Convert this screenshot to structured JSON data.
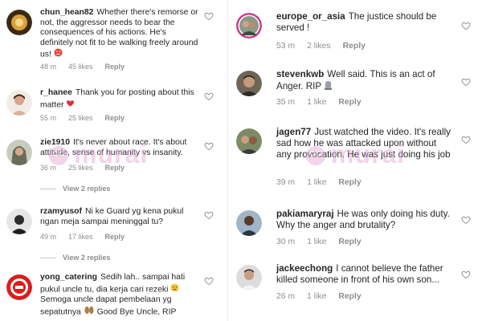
{
  "colors": {
    "accent_heart": "#e0303a",
    "watermark": "#e4a2d6",
    "meta_grey": "#8e8e8e"
  },
  "left_column": {
    "comments": [
      {
        "username": "chun_hean82",
        "text": "Whether there's remorse or not, the aggressor needs to bear the consequences of his actions. He's definitely not fit to be walking freely around us!",
        "emoji": "angry-face-icon",
        "time": "48 m",
        "likes": "45 likes",
        "reply": "Reply"
      },
      {
        "username": "r_hanee",
        "text": "Thank you for posting about this matter",
        "emoji": "red-heart-icon",
        "time": "55 m",
        "likes": "25 likes",
        "reply": "Reply"
      },
      {
        "username": "zie1910",
        "text": "It's never about race. It's about attitude, sense of humanity vs insanity.",
        "time": "36 m",
        "likes": "25 likes",
        "reply": "Reply",
        "view_replies": "View 2 replies"
      },
      {
        "username": "rzamyusof",
        "text": "Ni ke Guard yg kena pukul ngan meja sampai meninggal tu?",
        "time": "49 m",
        "likes": "17 likes",
        "reply": "Reply",
        "view_replies": "View 2 replies"
      },
      {
        "username": "yong_catering",
        "text": "Sedih lah.. sampai hati pukul uncle tu, dia kerja cari rezeki",
        "text2": "Semoga uncle dapat pembelaan yg sepatutnya",
        "text3": "Good Bye Uncle, RIP"
      }
    ]
  },
  "right_column": {
    "comments": [
      {
        "username": "europe_or_asia",
        "text": "The justice should be served !",
        "time": "53 m",
        "likes": "2 likes",
        "reply": "Reply"
      },
      {
        "username": "stevenkwb",
        "text": "Well said. This is an act of Anger. RIP",
        "time": "35 m",
        "likes": "1 like",
        "reply": "Reply"
      },
      {
        "username": "jagen77",
        "text": "Just watched the video. It's really sad how he was attacked upon without any provocation. He was just doing his job",
        "time": "39 m",
        "likes": "1 like",
        "reply": "Reply"
      },
      {
        "username": "pakiamaryraj",
        "text": "He was only doing his duty. Why the anger and brutality?",
        "time": "30 m",
        "likes": "1 like",
        "reply": "Reply"
      },
      {
        "username": "jackeechong",
        "text": "I cannot believe the father killed someone in front of his own son...",
        "time": "26 m",
        "likes": "1 like",
        "reply": "Reply"
      }
    ]
  },
  "watermark": {
    "text": "murai"
  }
}
